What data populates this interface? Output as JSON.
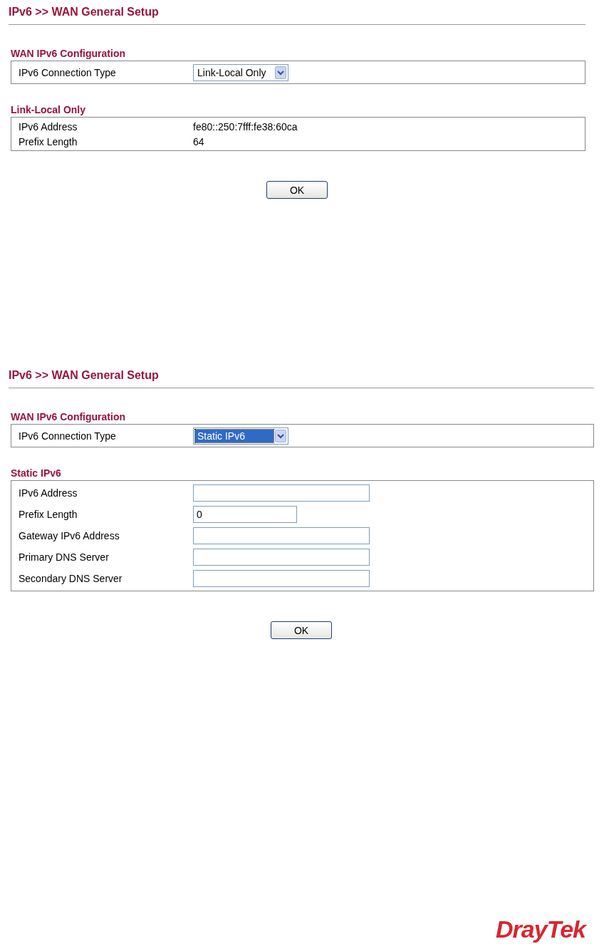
{
  "screens": [
    {
      "title": "IPv6 >> WAN General Setup",
      "config": {
        "heading": "WAN IPv6 Configuration",
        "label": "IPv6 Connection Type",
        "value": "Link-Local Only",
        "highlighted": false
      },
      "section": {
        "heading": "Link-Local Only",
        "rows": [
          {
            "kind": "text",
            "label": "IPv6 Address",
            "value": "fe80::250:7fff:fe38:60ca"
          },
          {
            "kind": "text",
            "label": "Prefix Length",
            "value": "64"
          }
        ]
      },
      "button": "OK"
    },
    {
      "title": "IPv6 >> WAN General Setup",
      "config": {
        "heading": "WAN IPv6 Configuration",
        "label": "IPv6 Connection Type",
        "value": "Static IPv6",
        "highlighted": true
      },
      "section": {
        "heading": "Static IPv6",
        "rows": [
          {
            "kind": "field",
            "label": "IPv6 Address"
          },
          {
            "kind": "short-field",
            "label": "Prefix Length",
            "value": "0"
          },
          {
            "kind": "field",
            "label": "Gateway IPv6 Address"
          },
          {
            "kind": "field",
            "label": "Primary DNS Server"
          },
          {
            "kind": "field",
            "label": "Secondary DNS Server"
          }
        ]
      },
      "button": "OK"
    }
  ],
  "logo": "DrayTek"
}
